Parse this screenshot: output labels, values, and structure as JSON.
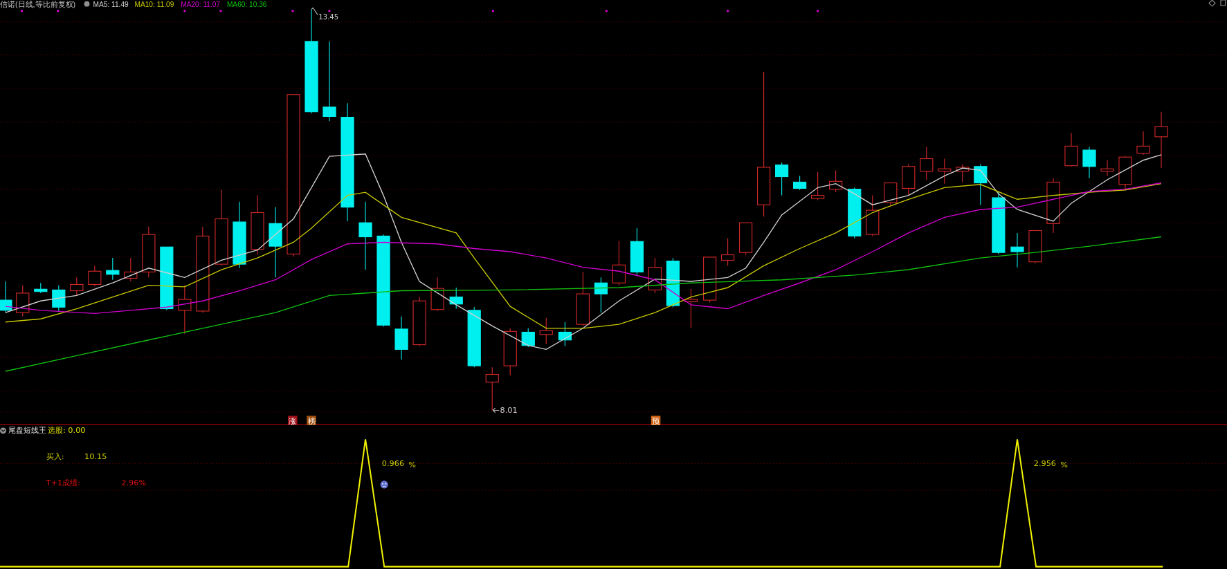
{
  "header": {
    "title": "信诺(日线,等比前复权)",
    "indicators": [
      {
        "label": "MA5: 11.49",
        "color": "#d0d0d0"
      },
      {
        "label": "MA10: 11.09",
        "color": "#c8c800"
      },
      {
        "label": "MA20: 11.07",
        "color": "#d000d0"
      },
      {
        "label": "MA60: 10.36",
        "color": "#10c010"
      }
    ]
  },
  "price_labels": {
    "high": "13.45",
    "low": "8.01"
  },
  "badges": [
    {
      "text": "涨",
      "color": "#a01018"
    },
    {
      "text": "榜",
      "color": "#a05010"
    },
    {
      "text": "预",
      "color": "#d06010"
    }
  ],
  "indicator_panel": {
    "name": "尾盘短线王",
    "value": "选股: 0.00",
    "rows": [
      {
        "kind": "buy",
        "label": "买入:",
        "value": "10.15"
      },
      {
        "kind": "result",
        "label": "T+1成绩:",
        "value": "2.96%"
      }
    ],
    "signals": [
      {
        "value": "0.966",
        "unit": "%",
        "face_icon": true
      },
      {
        "value": "2.956",
        "unit": "%",
        "face_icon": false
      }
    ]
  }
}
